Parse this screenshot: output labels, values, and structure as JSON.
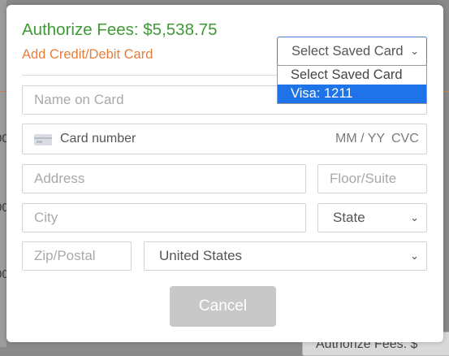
{
  "modal": {
    "title": "Authorize Fees: $5,538.75",
    "subtitle": "Add Credit/Debit Card",
    "saved_card": {
      "selected": "Select Saved Card",
      "options": [
        "Select Saved Card",
        "Visa: 1211"
      ],
      "highlighted_index": 1
    },
    "fields": {
      "name_on_card": "Name on Card",
      "card_number": "Card number",
      "expiry": "MM / YY",
      "cvc": "CVC",
      "address": "Address",
      "floor_suite": "Floor/Suite",
      "city": "City",
      "state": "State",
      "zip": "Zip/Postal",
      "country": "United States"
    },
    "cancel_label": "Cancel"
  },
  "background": {
    "bottom_text": "Authorize Fees: $"
  },
  "colors": {
    "title_green": "#3f9a36",
    "subtitle_orange": "#e67e3a",
    "select_blue": "#1e73e8",
    "button_gray": "#c8c8c8"
  },
  "icons": {
    "card": "credit-card-icon",
    "chevron": "chevron-down-icon"
  }
}
